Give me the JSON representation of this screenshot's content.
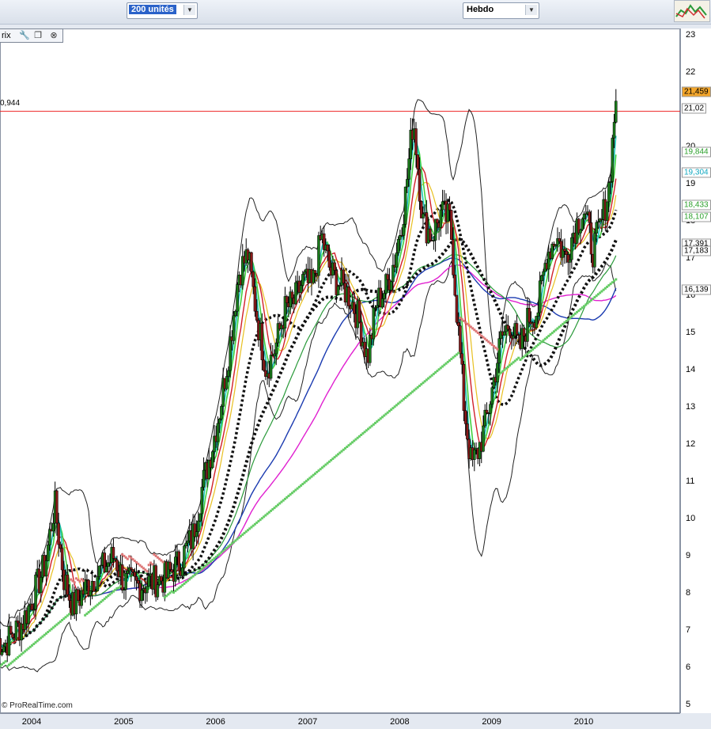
{
  "toolbar": {
    "units": "200 unités",
    "period": "Hebdo"
  },
  "panel": {
    "header_text": "rix",
    "wrench_icon": "wrench-icon",
    "window_icon": "window-icon",
    "close_icon": "close-icon"
  },
  "watermark": "© ProRealTime.com",
  "hline_text": "0,944",
  "colors": {
    "up": "#1a7a1a",
    "down": "#8b1a1a",
    "sar_down": "#d77",
    "sar_up": "#6c6",
    "hline": "#e22",
    "mavg_pink": "#e020d0",
    "mavg_blue": "#1a3ab0",
    "mavg_green": "#2a9a3a",
    "mavg_black": "#111",
    "boll": "#222",
    "cyan": "#18c8b8",
    "lime": "#40d040",
    "red": "#d0202a",
    "yellow": "#e8c020"
  },
  "chart_data": {
    "type": "line",
    "title": "",
    "xlabel": "",
    "ylabel": "",
    "x_ticks": [
      "2004",
      "2005",
      "2006",
      "2007",
      "2008",
      "2009",
      "2010"
    ],
    "y_ticks": [
      5,
      6,
      7,
      8,
      9,
      10,
      11,
      12,
      13,
      14,
      15,
      16,
      17,
      18,
      19,
      20,
      21,
      22,
      23
    ],
    "ylim": [
      4.9,
      23.1
    ],
    "grid": false,
    "price_labels": [
      {
        "value": "21,459",
        "y": 21.459,
        "bg": "#f2a52a",
        "fg": "#000"
      },
      {
        "value": "21,02",
        "y": 21.02,
        "bg": "#fff",
        "fg": "#000"
      },
      {
        "value": "19,844",
        "y": 19.844,
        "bg": "#fff",
        "fg": "#2aa02a"
      },
      {
        "value": "19,304",
        "y": 19.304,
        "bg": "#fff",
        "fg": "#10a8c0"
      },
      {
        "value": "18,433",
        "y": 18.433,
        "bg": "#fff",
        "fg": "#2aa02a"
      },
      {
        "value": "18,107",
        "y": 18.107,
        "bg": "#fff",
        "fg": "#2aa02a"
      },
      {
        "value": "17,391",
        "y": 17.391,
        "bg": "#fff",
        "fg": "#000"
      },
      {
        "value": "17,183",
        "y": 17.183,
        "bg": "#fff",
        "fg": "#000"
      },
      {
        "value": "16,139",
        "y": 16.139,
        "bg": "#fff",
        "fg": "#000"
      }
    ],
    "hline": 20.944,
    "series": [
      {
        "key": "close",
        "values": [
          [
            2003.5,
            7.0
          ],
          [
            2003.7,
            6.6
          ],
          [
            2003.9,
            7.2
          ],
          [
            2004.0,
            7.8
          ],
          [
            2004.15,
            8.8
          ],
          [
            2004.25,
            10.4
          ],
          [
            2004.35,
            8.4
          ],
          [
            2004.45,
            7.6
          ],
          [
            2004.6,
            8.2
          ],
          [
            2004.75,
            8.6
          ],
          [
            2004.9,
            9.0
          ],
          [
            2005.0,
            8.3
          ],
          [
            2005.15,
            8.2
          ],
          [
            2005.3,
            8.3
          ],
          [
            2005.45,
            8.4
          ],
          [
            2005.6,
            8.8
          ],
          [
            2005.75,
            9.5
          ],
          [
            2005.85,
            10.8
          ],
          [
            2005.95,
            11.8
          ],
          [
            2006.05,
            13.0
          ],
          [
            2006.15,
            14.6
          ],
          [
            2006.25,
            16.6
          ],
          [
            2006.35,
            17.1
          ],
          [
            2006.45,
            15.4
          ],
          [
            2006.55,
            14.0
          ],
          [
            2006.65,
            14.6
          ],
          [
            2006.75,
            15.6
          ],
          [
            2006.85,
            15.8
          ],
          [
            2006.95,
            16.4
          ],
          [
            2007.05,
            16.2
          ],
          [
            2007.15,
            17.6
          ],
          [
            2007.25,
            16.6
          ],
          [
            2007.35,
            16.3
          ],
          [
            2007.45,
            16.0
          ],
          [
            2007.55,
            15.4
          ],
          [
            2007.65,
            14.3
          ],
          [
            2007.75,
            15.8
          ],
          [
            2007.85,
            16.2
          ],
          [
            2007.95,
            17.0
          ],
          [
            2008.05,
            18.4
          ],
          [
            2008.15,
            20.8
          ],
          [
            2008.25,
            18.0
          ],
          [
            2008.35,
            17.6
          ],
          [
            2008.45,
            18.2
          ],
          [
            2008.55,
            18.0
          ],
          [
            2008.62,
            15.6
          ],
          [
            2008.7,
            13.0
          ],
          [
            2008.78,
            11.4
          ],
          [
            2008.85,
            11.8
          ],
          [
            2008.92,
            12.4
          ],
          [
            2009.0,
            13.4
          ],
          [
            2009.1,
            14.8
          ],
          [
            2009.2,
            15.3
          ],
          [
            2009.3,
            14.5
          ],
          [
            2009.4,
            15.4
          ],
          [
            2009.5,
            15.6
          ],
          [
            2009.6,
            17.1
          ],
          [
            2009.7,
            17.6
          ],
          [
            2009.8,
            17.0
          ],
          [
            2009.9,
            17.8
          ],
          [
            2010.0,
            18.3
          ],
          [
            2010.1,
            17.2
          ],
          [
            2010.2,
            18.0
          ],
          [
            2010.28,
            19.0
          ],
          [
            2010.35,
            21.4
          ]
        ]
      }
    ]
  }
}
